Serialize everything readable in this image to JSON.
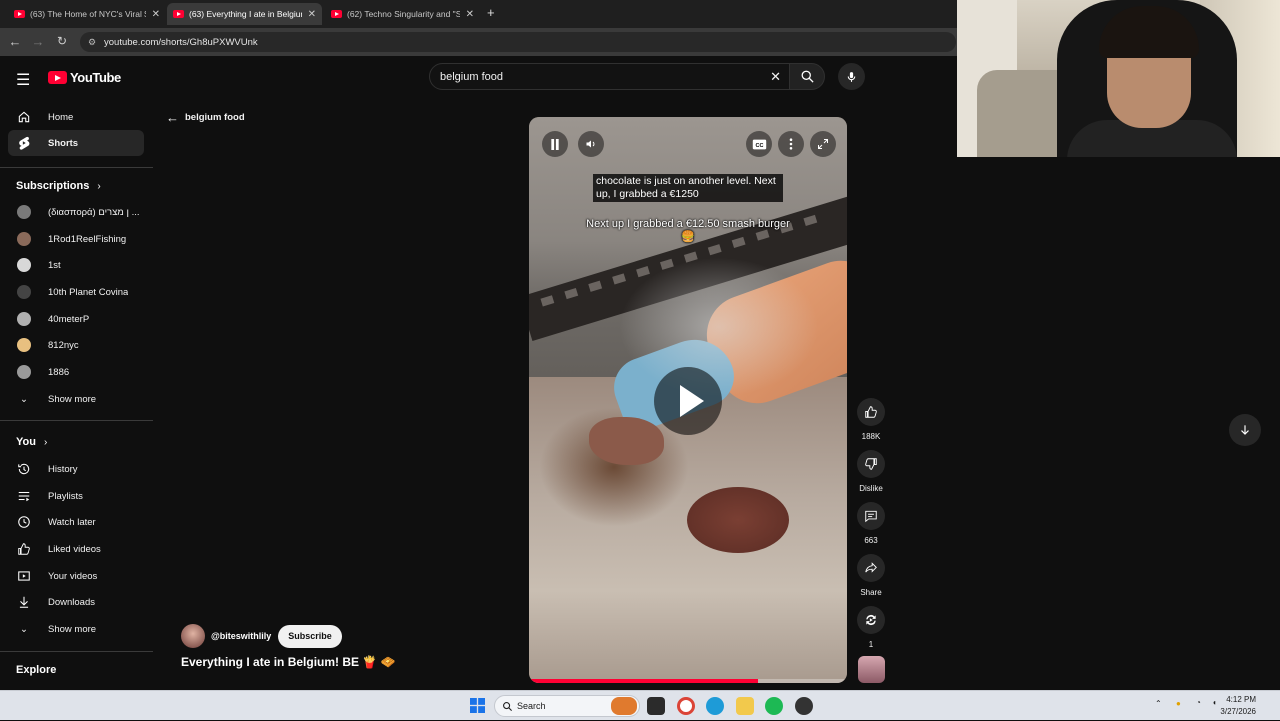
{
  "browser": {
    "tabs": [
      {
        "title": "(63) The Home of NYC's Viral $",
        "active": false
      },
      {
        "title": "(63) Everything I ate in Belgium",
        "active": true
      },
      {
        "title": "(62) Techno Singularity and \"Sa",
        "active": false
      }
    ],
    "new_tab": "+",
    "url": "youtube.com/shorts/Gh8uPXWVUnk"
  },
  "youtube": {
    "logo_text": "YouTube",
    "search_query": "belgium food",
    "back_label": "belgium food"
  },
  "sidebar": {
    "main": [
      {
        "label": "Home",
        "icon": "home-icon"
      },
      {
        "label": "Shorts",
        "icon": "shorts-icon",
        "active": true
      }
    ],
    "subscriptions_title": "Subscriptions",
    "subscriptions": [
      {
        "label": "(διασπορά) ן מצרים ...",
        "color": "#7a7a7a"
      },
      {
        "label": "1Rod1ReelFishing",
        "color": "#8a6a5a"
      },
      {
        "label": "1st",
        "color": "#d8d8d8"
      },
      {
        "label": "10th Planet Covina",
        "color": "#444444"
      },
      {
        "label": "40meterP",
        "color": "#b0b0b0"
      },
      {
        "label": "812nyc",
        "color": "#e8c080"
      },
      {
        "label": "1886",
        "color": "#9a9a9a"
      }
    ],
    "subs_show_more": "Show more",
    "you_title": "You",
    "you_items": [
      {
        "label": "History",
        "icon": "history-icon"
      },
      {
        "label": "Playlists",
        "icon": "playlists-icon"
      },
      {
        "label": "Watch later",
        "icon": "watch-later-icon"
      },
      {
        "label": "Liked videos",
        "icon": "liked-videos-icon"
      },
      {
        "label": "Your videos",
        "icon": "your-videos-icon"
      },
      {
        "label": "Downloads",
        "icon": "downloads-icon"
      }
    ],
    "you_show_more": "Show more",
    "explore_title": "Explore"
  },
  "video": {
    "caption_top": "chocolate is just on another level. Next up, I grabbed a €1250",
    "caption_main": "Next up I grabbed a €12.50 smash burger 🍔",
    "progress": 0.72
  },
  "actions": {
    "like_count": "188K",
    "dislike_label": "Dislike",
    "comment_count": "663",
    "share_label": "Share",
    "remix_count": "1"
  },
  "channel": {
    "handle": "@biteswithlily",
    "subscribe_label": "Subscribe",
    "video_title": "Everything I ate in Belgium! BE 🍟 🧇"
  },
  "taskbar": {
    "search_label": "Search",
    "time": "4:12 PM",
    "date": "3/27/2026"
  },
  "colors": {
    "accent": "#ff0033",
    "background": "#0f0f0f",
    "sidebar_active": "#272727"
  }
}
